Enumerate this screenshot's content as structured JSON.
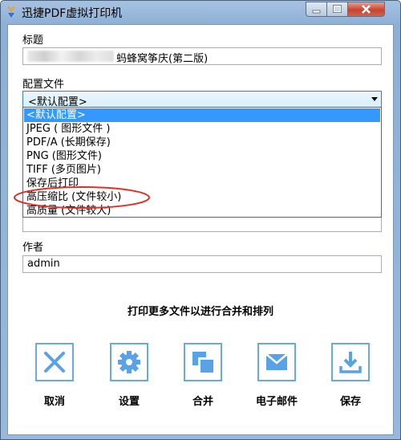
{
  "window": {
    "title": "迅捷PDF虚拟打印机"
  },
  "form": {
    "title_label": "标题",
    "title_value": "蚂蜂窝筝庆(第二版)",
    "profile_label": "配置文件",
    "profile_selected": "<默认配置>",
    "profile_options": [
      "<默认配置>",
      "JPEG ( 图形文件 )",
      "PDF/A (长期保存)",
      "PNG (图形文件)",
      "TIFF (多页图片)",
      "保存后打印",
      "高压缩比 (文件较小)",
      "高质量 (文件较大)"
    ],
    "author_label": "作者",
    "author_value": "admin"
  },
  "hint": "打印更多文件以进行合并和排列",
  "actions": [
    {
      "label": "取消",
      "icon": "close-icon"
    },
    {
      "label": "设置",
      "icon": "gear-icon"
    },
    {
      "label": "合并",
      "icon": "merge-icon"
    },
    {
      "label": "电子邮件",
      "icon": "envelope-icon"
    },
    {
      "label": "保存",
      "icon": "download-icon"
    }
  ],
  "colors": {
    "accent": "#5aa2e6",
    "selection": "#3399ff",
    "annotation": "#e0302a"
  }
}
